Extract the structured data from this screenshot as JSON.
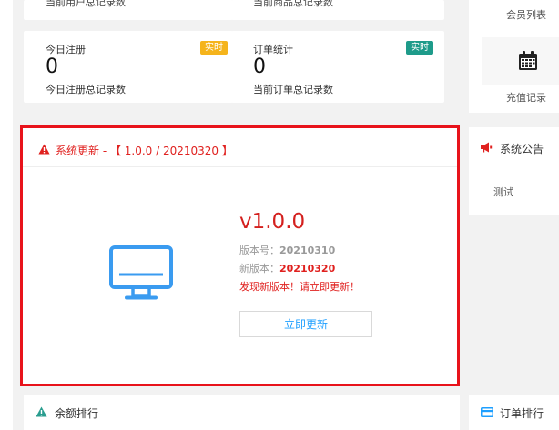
{
  "stats_top": {
    "left_desc": "当前用户总记录数",
    "right_desc": "当前商品总记录数"
  },
  "stats": [
    {
      "title": "今日注册",
      "badge": "实时",
      "badge_color": "#f5b41c",
      "value": "0",
      "desc": "今日注册总记录数"
    },
    {
      "title": "订单统计",
      "badge": "实时",
      "badge_color": "#1e9b8a",
      "value": "0",
      "desc": "当前订单总记录数"
    }
  ],
  "sidebar_right": {
    "member_list": "会员列表",
    "recharge_record": "充值记录",
    "notice_title": "系统公告",
    "notice_item": "测试",
    "order_rank_title": "订单排行"
  },
  "update": {
    "title": "系统更新 - 【 1.0.0 / 20210320 】",
    "version": "v1.0.0",
    "build_label": "版本号：",
    "build_value": "20210310",
    "new_label": "新版本：",
    "new_value": "20210320",
    "notice": "发现新版本！请立即更新！",
    "button_label": "立即更新"
  },
  "balance_rank": {
    "title": "余额排行"
  },
  "colors": {
    "accent_red": "#e8131b",
    "accent_blue": "#1e9fff",
    "warn_orange": "#f0a020",
    "icon_teal": "#2a9d8f"
  },
  "icons": {
    "alert": "warning-triangle-icon",
    "monitor": "monitor-icon",
    "calendar": "calendar-icon",
    "megaphone": "megaphone-icon",
    "card": "credit-card-icon"
  }
}
